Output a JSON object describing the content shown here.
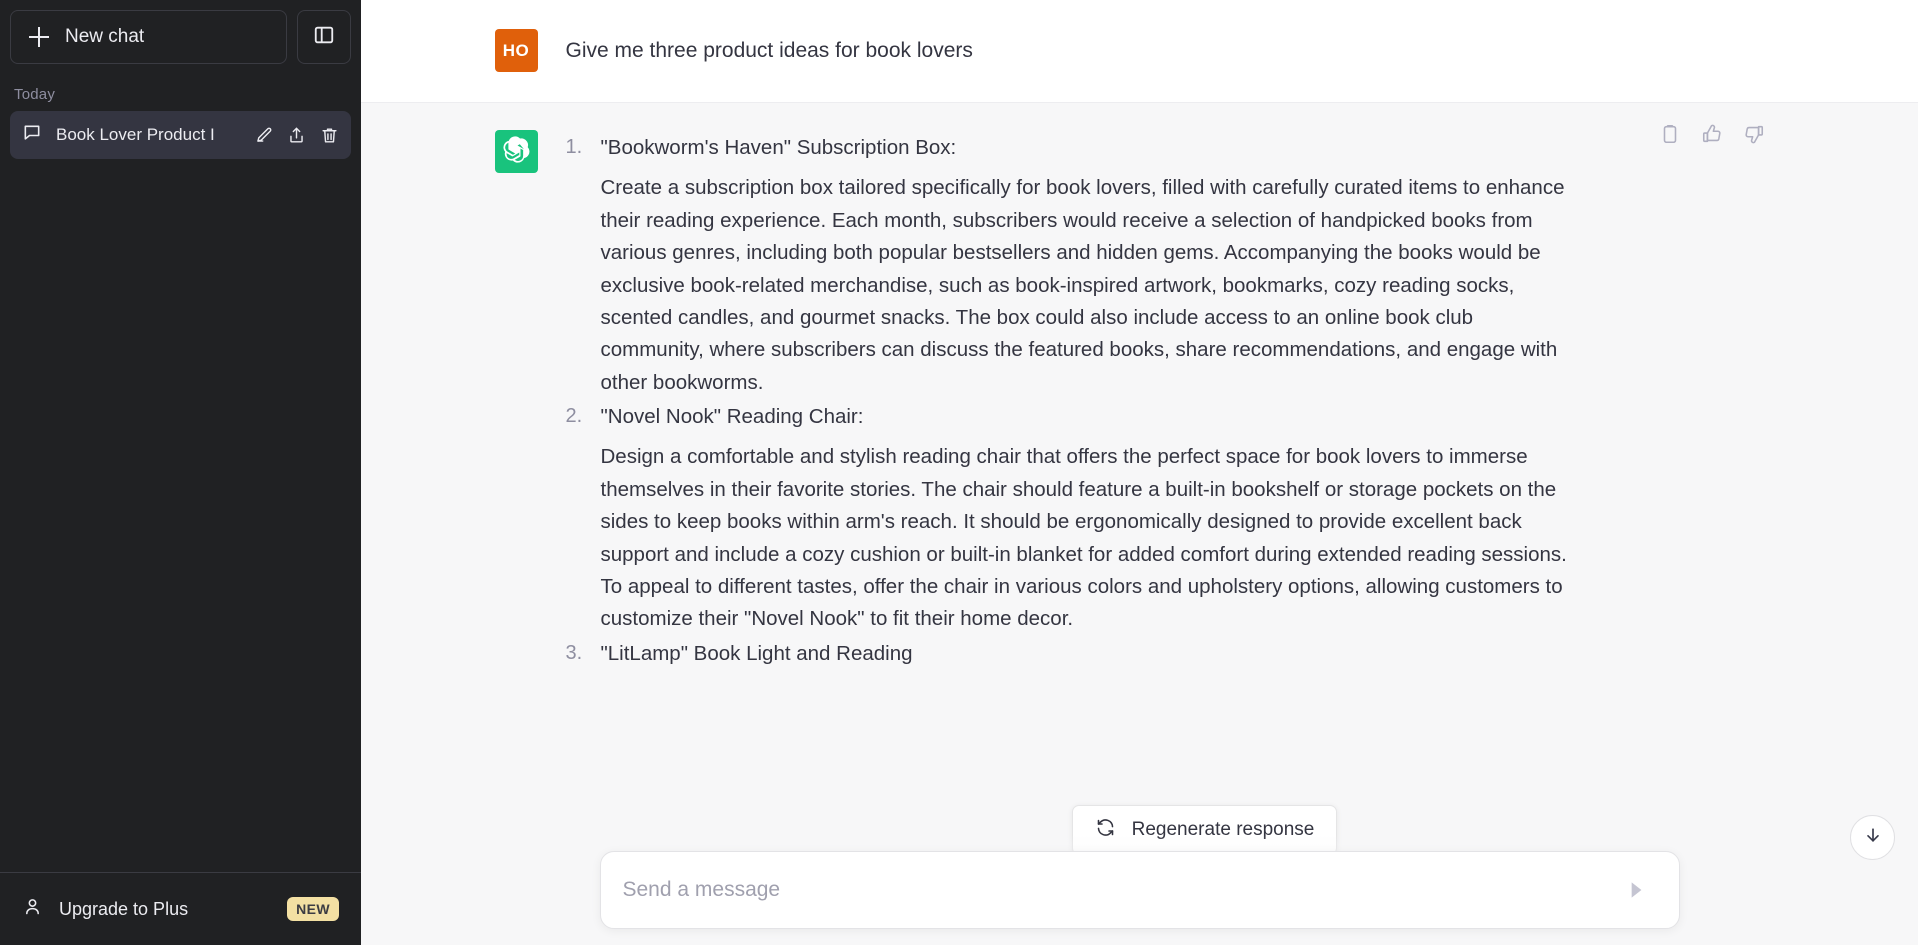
{
  "sidebar": {
    "new_chat_label": "New chat",
    "new_chat_icon": "plus-icon",
    "toggle_icon": "sidebar-panel-icon",
    "section_label": "Today",
    "chats": [
      {
        "title": "Book Lover Product I",
        "icon": "chat-bubble-icon",
        "actions": [
          "pencil-edit-icon",
          "share-upload-icon",
          "trash-delete-icon"
        ],
        "active": true
      }
    ],
    "upgrade": {
      "label": "Upgrade to Plus",
      "icon": "person-icon",
      "badge": "NEW",
      "badge_color": "#F3E0A3"
    },
    "background_color": "#202123",
    "active_item_color": "#343541"
  },
  "conversation": {
    "messages": [
      {
        "role": "user",
        "avatar_initials": "HO",
        "avatar_color": "#E0600B",
        "text": "Give me three product ideas for book lovers"
      },
      {
        "role": "assistant",
        "avatar_icon": "openai-logo-icon",
        "avatar_color": "#19C37D",
        "ideas": [
          {
            "heading": "\"Bookworm's Haven\" Subscription Box:",
            "body": "Create a subscription box tailored specifically for book lovers, filled with carefully curated items to enhance their reading experience. Each month, subscribers would receive a selection of handpicked books from various genres, including both popular bestsellers and hidden gems. Accompanying the books would be exclusive book-related merchandise, such as book-inspired artwork, bookmarks, cozy reading socks, scented candles, and gourmet snacks. The box could also include access to an online book club community, where subscribers can discuss the featured books, share recommendations, and engage with other bookworms."
          },
          {
            "heading": "\"Novel Nook\" Reading Chair:",
            "body": "Design a comfortable and stylish reading chair that offers the perfect space for book lovers to immerse themselves in their favorite stories. The chair should feature a built-in bookshelf or storage pockets on the sides to keep books within arm's reach. It should be ergonomically designed to provide excellent back support and include a cozy cushion or built-in blanket for added comfort during extended reading sessions. To appeal to different tastes, offer the chair in various colors and upholstery options, allowing customers to customize their \"Novel Nook\" to fit their home decor."
          },
          {
            "heading": "\"LitLamp\" Book Light and Reading",
            "body": ""
          }
        ],
        "actions": [
          "copy-clipboard-icon",
          "thumbs-up-icon",
          "thumbs-down-icon"
        ]
      }
    ]
  },
  "regenerate": {
    "label": "Regenerate response",
    "icon": "refresh-icon"
  },
  "composer": {
    "placeholder": "Send a message",
    "value": "",
    "send_icon": "send-arrow-icon"
  },
  "scroll_to_bottom": {
    "icon": "arrow-down-icon"
  }
}
